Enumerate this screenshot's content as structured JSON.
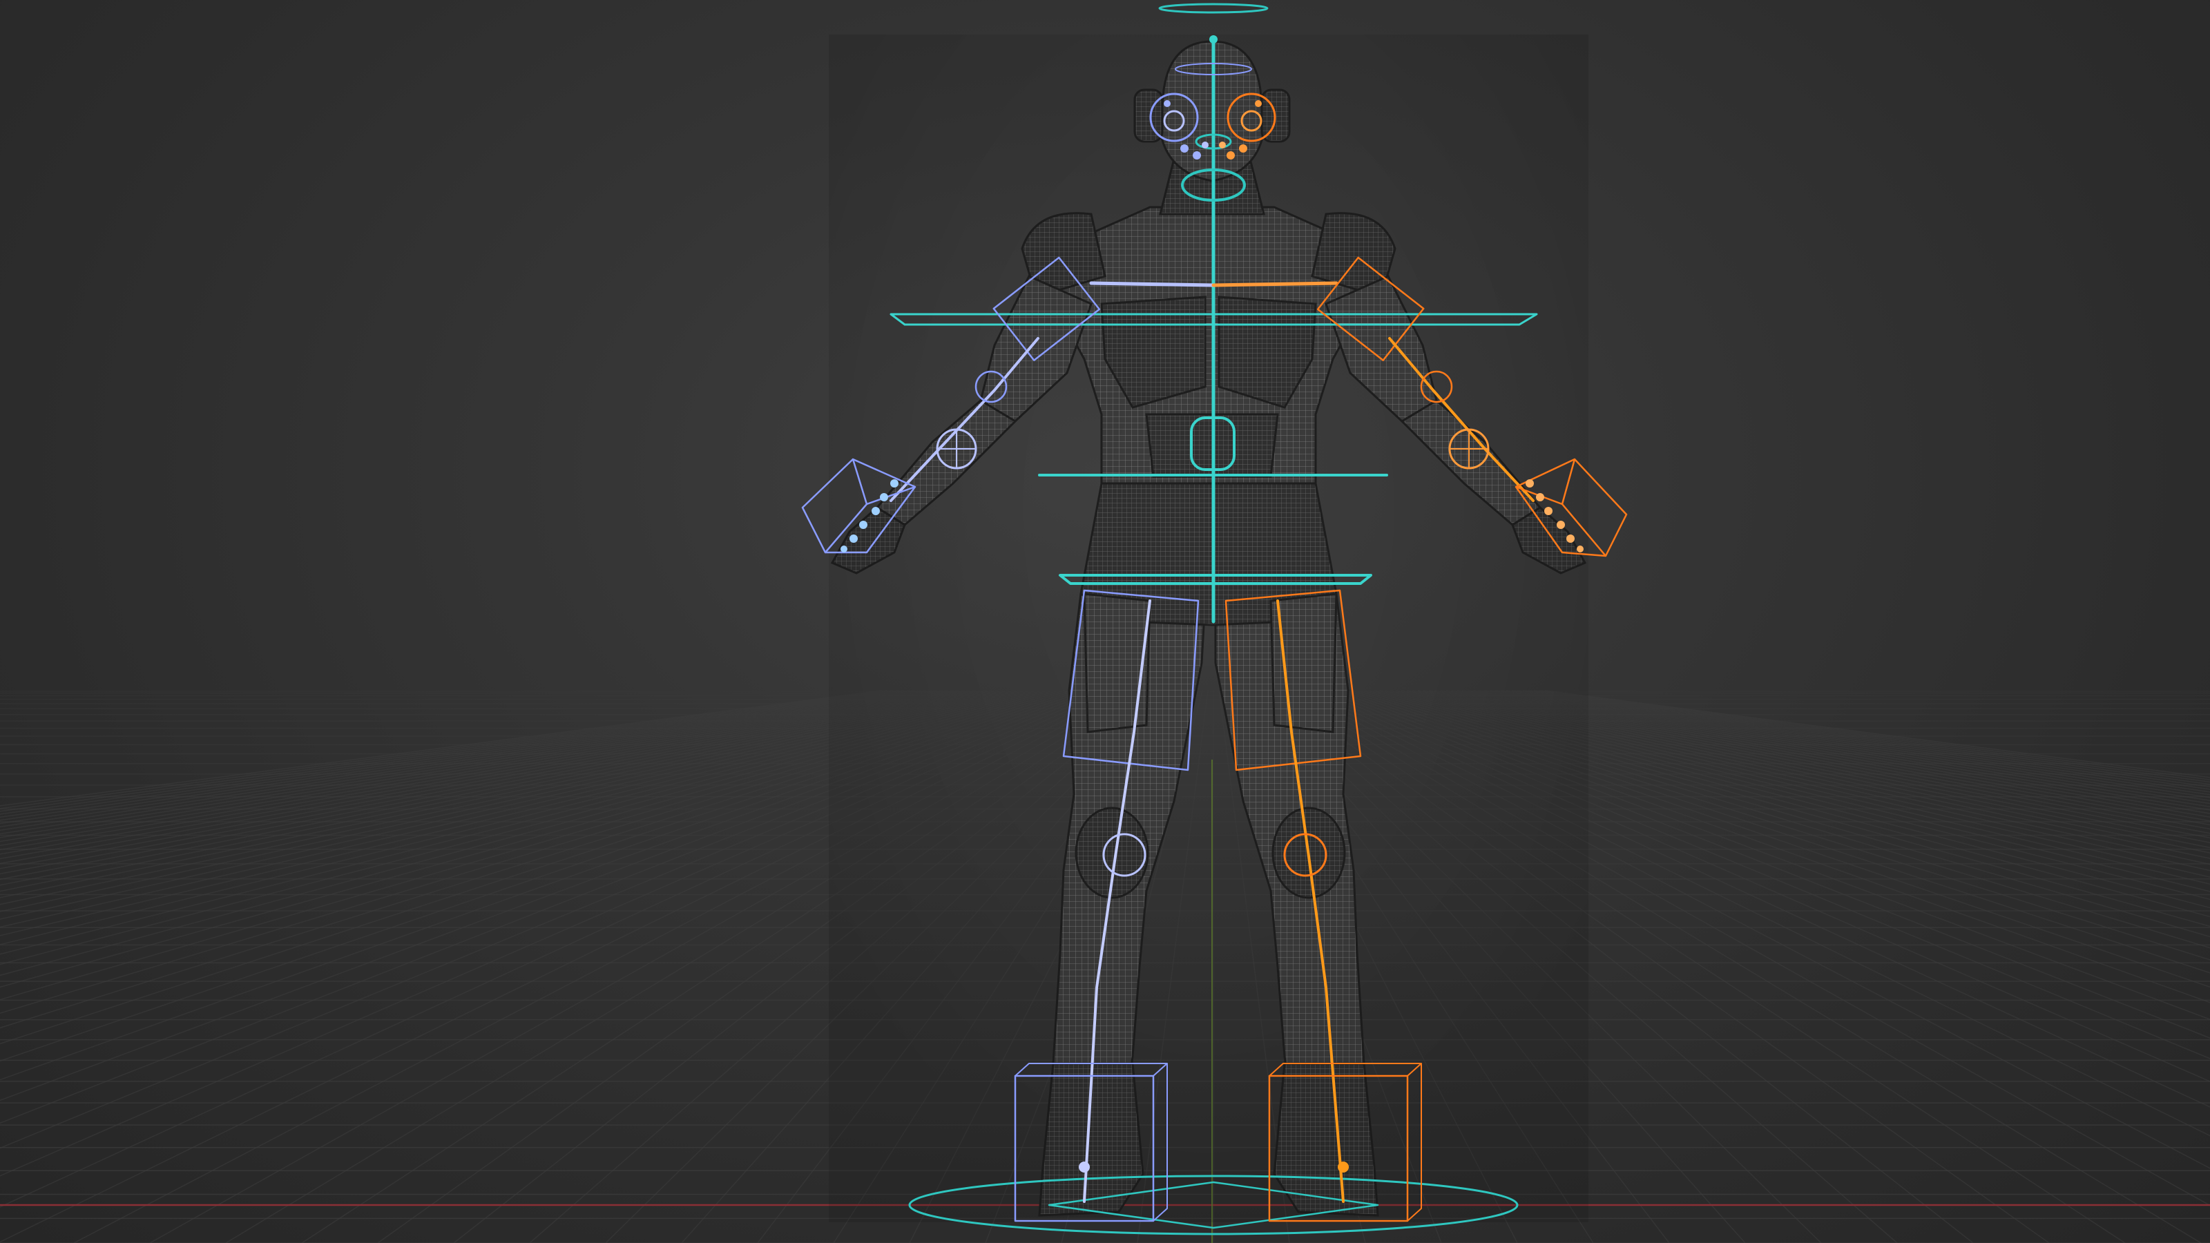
{
  "viewport": {
    "colors": {
      "background": "#353535",
      "grid": "#3c3c3c",
      "x_axis": "#8a2f35",
      "y_axis": "#5d7a2e",
      "root_control": "#2fc7c0",
      "spine_control": "#3ad4cc",
      "left_side_controls": "#8a9cff",
      "right_side_controls": "#ff7a1a",
      "mesh_fill": "#3a3a3a",
      "mesh_wire": "#a8a8a8"
    },
    "objects": [
      {
        "name": "character-mesh",
        "type": "wireframe-mesh",
        "pose": "A-pose"
      },
      {
        "name": "armature",
        "type": "rig"
      }
    ],
    "controls": [
      {
        "name": "head-halo",
        "color": "cyan"
      },
      {
        "name": "neck-control",
        "color": "cyan"
      },
      {
        "name": "shoulder-plane",
        "color": "cyan"
      },
      {
        "name": "chest-plane",
        "color": "cyan"
      },
      {
        "name": "hips-plane",
        "color": "cyan"
      },
      {
        "name": "root-circle",
        "color": "cyan"
      },
      {
        "name": "left-arm-ik",
        "color": "blue"
      },
      {
        "name": "right-arm-ik",
        "color": "orange"
      },
      {
        "name": "left-leg-ik",
        "color": "blue"
      },
      {
        "name": "right-leg-ik",
        "color": "orange"
      },
      {
        "name": "left-foot-box",
        "color": "blue"
      },
      {
        "name": "right-foot-box",
        "color": "orange"
      }
    ]
  }
}
